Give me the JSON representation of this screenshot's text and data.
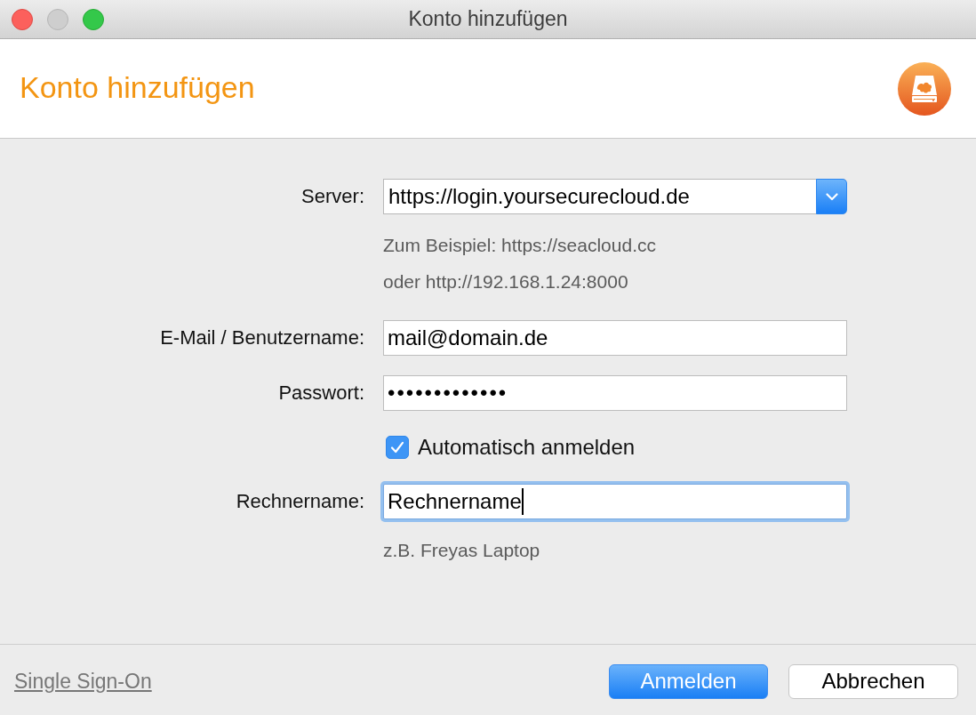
{
  "window": {
    "title": "Konto hinzufügen",
    "controls": [
      {
        "kind": "close",
        "disabled": false
      },
      {
        "kind": "minimize",
        "disabled": true
      },
      {
        "kind": "zoom",
        "disabled": false
      }
    ]
  },
  "header": {
    "title": "Konto hinzufügen"
  },
  "form": {
    "fields": [
      {
        "kind": "combobox",
        "label": "Server:",
        "value": "https://login.yoursecurecloud.de",
        "hints": [
          "Zum Beispiel: https://seacloud.cc",
          "oder http://192.168.1.24:8000"
        ]
      },
      {
        "kind": "text",
        "label": "E-Mail / Benutzername:",
        "value": "mail@domain.de",
        "focused": false
      },
      {
        "kind": "password",
        "label": "Passwort:",
        "value": "•••••••••••••",
        "focused": false
      },
      {
        "kind": "checkbox",
        "label": "Automatisch anmelden",
        "checked": true
      },
      {
        "kind": "text",
        "label": "Rechnername:",
        "value": "Rechnername",
        "focused": true,
        "hints": [
          "z.B. Freyas Laptop"
        ]
      }
    ]
  },
  "footer": {
    "link": "Single Sign-On",
    "buttons": [
      {
        "label": "Anmelden",
        "kind": "primary"
      },
      {
        "label": "Abbrechen",
        "kind": "secondary"
      }
    ]
  }
}
